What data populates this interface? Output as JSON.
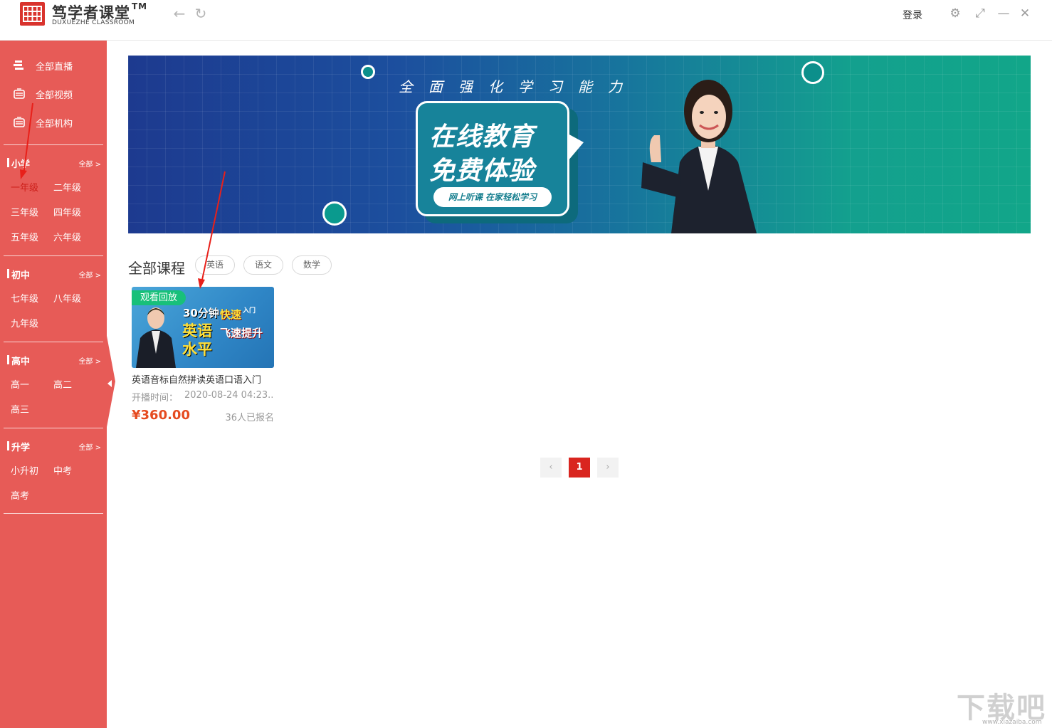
{
  "app": {
    "brand_name": "笃学者课堂",
    "brand_tm": "TM",
    "brand_sub": "DUXUEZHE CLASSROOM",
    "login": "登录"
  },
  "icons": {
    "back": "←",
    "refresh": "↻",
    "settings": "⚙",
    "fullscreen": "⤢",
    "minimize": "—",
    "close": "✕"
  },
  "colors": {
    "sidebar": "#e75b57",
    "accent": "#d9251f",
    "price": "#e54b20",
    "badge": "#18c07a"
  },
  "sidebar": {
    "top_items": [
      {
        "label": "全部直播"
      },
      {
        "label": "全部视频"
      },
      {
        "label": "全部机构"
      }
    ],
    "groups": [
      {
        "title": "小学",
        "all": "全部 >",
        "grades": [
          "一年级",
          "二年级",
          "三年级",
          "四年级",
          "五年级",
          "六年级"
        ]
      },
      {
        "title": "初中",
        "all": "全部 >",
        "grades": [
          "七年级",
          "八年级",
          "九年级"
        ]
      },
      {
        "title": "高中",
        "all": "全部 >",
        "grades": [
          "高一",
          "高二",
          "高三"
        ]
      },
      {
        "title": "升学",
        "all": "全部 >",
        "grades": [
          "小升初",
          "中考",
          "高考"
        ]
      }
    ],
    "active_grade": "一年级"
  },
  "banner": {
    "slogan": "全面强化学习能力",
    "line1": "在线教育",
    "line2": "免费体验",
    "pill": "网上听课 在家轻松学习"
  },
  "courses": {
    "section_title": "全部课程",
    "filters": [
      "英语",
      "语文",
      "数学"
    ],
    "items": [
      {
        "badge": "观看回放",
        "thumb_lines": [
          "30分钟",
          "快速",
          "入门",
          "英语",
          "水平",
          "飞速提升"
        ],
        "title": "英语音标自然拼读英语口语入门",
        "time_label": "开播时间：",
        "time": "2020-08-24 04:23...",
        "price": "¥360.00",
        "enrolled": "36人已报名"
      }
    ]
  },
  "pagination": {
    "prev": "‹",
    "current": "1",
    "next": "›"
  },
  "watermark": {
    "text": "下载吧",
    "url": "www.xiazaiba.com"
  }
}
